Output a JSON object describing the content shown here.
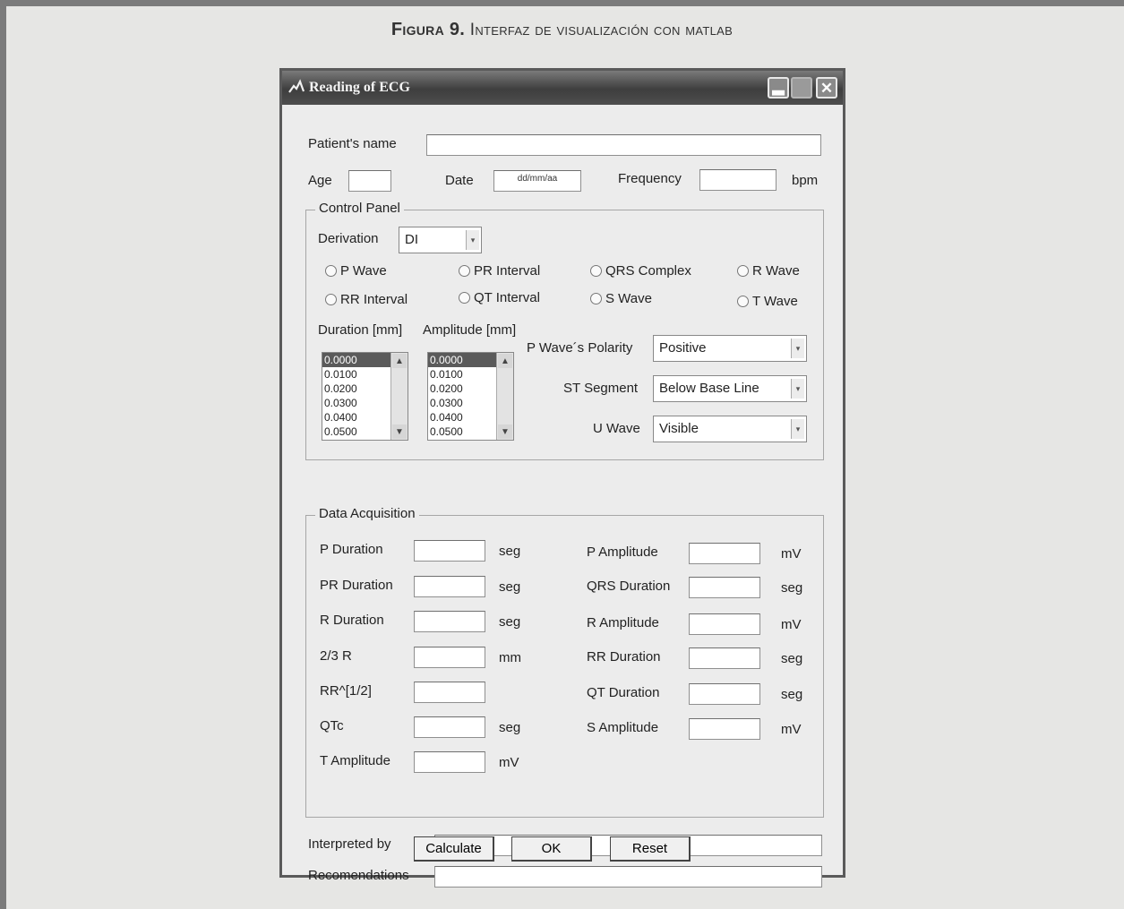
{
  "caption": {
    "label": "Figura 9.",
    "text": "Interfaz de visualización con matlab"
  },
  "window": {
    "title": "Reading of ECG"
  },
  "patient": {
    "name_label": "Patient's name",
    "age_label": "Age",
    "date_label": "Date",
    "date_value": "dd/mm/aa",
    "frequency_label": "Frequency",
    "frequency_unit": "bpm"
  },
  "control_panel": {
    "title": "Control Panel",
    "derivation_label": "Derivation",
    "derivation_value": "DI",
    "radios": [
      "P Wave",
      "PR Interval",
      "QRS Complex",
      "R Wave",
      "RR Interval",
      "QT Interval",
      "S Wave",
      "T Wave"
    ],
    "duration_label": "Duration [mm]",
    "amplitude_label": "Amplitude [mm]",
    "duration_items": [
      "0.0000",
      "0.0100",
      "0.0200",
      "0.0300",
      "0.0400",
      "0.0500"
    ],
    "amplitude_items": [
      "0.0000",
      "0.0100",
      "0.0200",
      "0.0300",
      "0.0400",
      "0.0500"
    ],
    "polarity_label": "P Wave´s Polarity",
    "polarity_value": "Positive",
    "st_label": "ST Segment",
    "st_value": "Below Base Line",
    "u_label": "U Wave",
    "u_value": "Visible"
  },
  "data_acquisition": {
    "title": "Data Acquisition",
    "left_rows": [
      {
        "label": "P Duration",
        "unit": "seg"
      },
      {
        "label": "PR Duration",
        "unit": "seg"
      },
      {
        "label": "R Duration",
        "unit": "seg"
      },
      {
        "label": "2/3 R",
        "unit": "mm"
      },
      {
        "label": "RR^[1/2]",
        "unit": ""
      },
      {
        "label": "QTc",
        "unit": "seg"
      },
      {
        "label": "T Amplitude",
        "unit": "mV"
      }
    ],
    "right_rows": [
      {
        "label": "P Amplitude",
        "unit": "mV"
      },
      {
        "label": "QRS Duration",
        "unit": "seg"
      },
      {
        "label": "R Amplitude",
        "unit": "mV"
      },
      {
        "label": "RR Duration",
        "unit": "seg"
      },
      {
        "label": "QT Duration",
        "unit": "seg"
      },
      {
        "label": "S Amplitude",
        "unit": "mV"
      }
    ]
  },
  "footer": {
    "interpreted_label": "Interpreted by",
    "recommendations_label": "Recomendations",
    "calculate_label": "Calculate",
    "ok_label": "OK",
    "reset_label": "Reset"
  },
  "colors": {
    "titlebar": "#4e4e4e",
    "page_background": "#e6e6e4",
    "window_background": "#ececec",
    "frame": "#7b7b7b"
  }
}
